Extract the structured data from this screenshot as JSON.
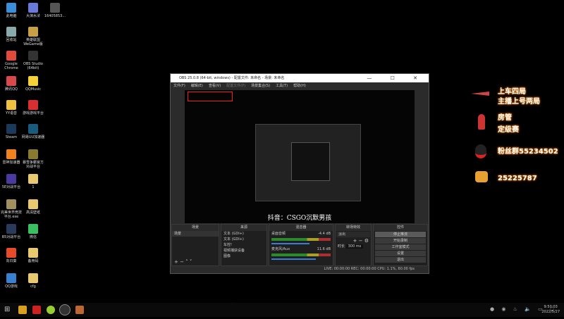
{
  "desktop_icons": [
    {
      "label": "此电脑",
      "color": "#3a8fd8"
    },
    {
      "label": "大演水浒",
      "color": "#6a7ad8"
    },
    {
      "label": "16405853...",
      "color": "#555"
    },
    {
      "label": "回收站",
      "color": "#8aa"
    },
    {
      "label": "英雄联盟WeGame版",
      "color": "#c9a04a"
    },
    {
      "label": "Google Chrome",
      "color": "#e04a3a"
    },
    {
      "label": "OBS Studio (64bit)",
      "color": "#333"
    },
    {
      "label": "腾讯QQ",
      "color": "#d84a4a"
    },
    {
      "label": "QQMusic",
      "color": "#f4d03a"
    },
    {
      "label": "YY语音",
      "color": "#f0c040"
    },
    {
      "label": "游戏游戏平台",
      "color": "#d83030"
    },
    {
      "label": "Steam",
      "color": "#1b3a5a"
    },
    {
      "label": "网易UU加速器",
      "color": "#1a5a7a"
    },
    {
      "label": "雷神加速器",
      "color": "#f08020"
    },
    {
      "label": "暴雪争霸官方对战平台",
      "color": "#887a30"
    },
    {
      "label": "5E对战平台",
      "color": "#4a3aa0"
    },
    {
      "label": "1",
      "color": "#e8c870"
    },
    {
      "label": "完美世界竞技平台.exe",
      "color": "#a09060"
    },
    {
      "label": "高清壁纸",
      "color": "#e8c870"
    },
    {
      "label": "B5对战平台",
      "color": "#2a3a5a"
    },
    {
      "label": "微信",
      "color": "#3ac060"
    },
    {
      "label": "向日葵",
      "color": "#e84a2a"
    },
    {
      "label": "备用码",
      "color": "#e8c870"
    },
    {
      "label": "QQ游戏",
      "color": "#3a80d0"
    },
    {
      "label": "cfg",
      "color": "#e8c870"
    }
  ],
  "obs": {
    "title": "OBS 25.0.8 (64-bit, windows) - 配置文件: 未命名 - 场景: 未命名",
    "window_controls": "— ☐ ✕",
    "menu": [
      "文件(F)",
      "编辑(E)",
      "查看(V)",
      "配置文件(P)",
      "场景集合(S)",
      "工具(T)",
      "帮助(H)"
    ],
    "preview_caption": "抖音：CSGO沉默男孩",
    "docks": {
      "scenes": {
        "title": "场景",
        "items": [
          "场景"
        ]
      },
      "sources": {
        "title": "来源",
        "items": [
          "文本 (GDI+)",
          "文本 (GDI+)",
          "车控!",
          "视频捕获设备",
          "图像"
        ]
      },
      "mixer": {
        "title": "混音器",
        "channels": [
          {
            "name": "桌面音频",
            "level": "-4.4 dB"
          },
          {
            "name": "麦克风/Aux",
            "level": "11.6 dB"
          }
        ]
      },
      "transitions": {
        "title": "转场特效",
        "selected": "淡出",
        "duration_label": "时长",
        "duration": "300 ms"
      },
      "controls": {
        "title": "控件",
        "buttons": [
          "停止推流",
          "开始录制",
          "工作室模式",
          "设置",
          "退出"
        ]
      }
    },
    "status": "LIVE: 00:00:00   REC: 00:00:00   CPU: 1.1%, 60.00 fps"
  },
  "overlay": [
    "上车四局",
    "主播上号两局",
    "房管",
    "定级赛",
    "粉丝群55234502",
    "25225787"
  ],
  "subtitle": "抖音：CSGO沉默男孩",
  "clock": {
    "time": "9:50:03",
    "date": "2022/5/27"
  }
}
